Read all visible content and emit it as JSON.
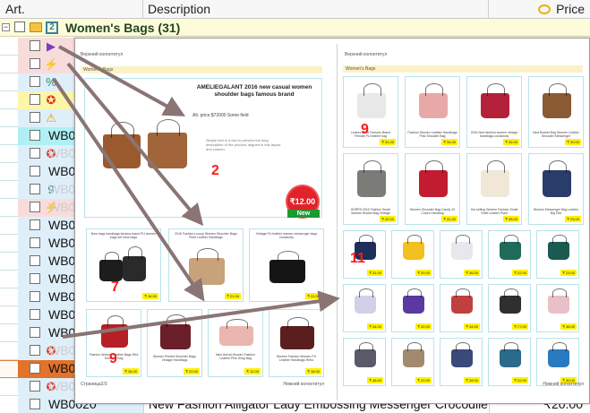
{
  "grid": {
    "columns": {
      "art": "Art.",
      "description": "Description",
      "price": "Price"
    },
    "group": {
      "toggle": "−",
      "icon_text": "2",
      "title": "Women's Bags   (31)"
    },
    "rows": [
      {
        "art": "",
        "icon": "flag-icon",
        "glyph": "▶",
        "desc": "",
        "price": ""
      },
      {
        "art": "",
        "icon": "lightning-icon",
        "glyph": "⚡",
        "desc": "",
        "price": ""
      },
      {
        "art": "",
        "icon": "percent-icon",
        "glyph": "%",
        "desc": "",
        "price": ""
      },
      {
        "art": "",
        "icon": "award-icon",
        "glyph": "✪",
        "desc": "",
        "price": ""
      },
      {
        "art": "",
        "icon": "warning-icon",
        "glyph": "⚠",
        "desc": "",
        "price": ""
      },
      {
        "art": "WB0",
        "icon": "",
        "glyph": "",
        "desc": "",
        "price": ""
      },
      {
        "art": "WB0",
        "icon": "award-icon",
        "glyph": "✪",
        "desc": "",
        "price": ""
      },
      {
        "art": "WB0",
        "icon": "",
        "glyph": "",
        "desc": "",
        "price": ""
      },
      {
        "art": "WB0",
        "icon": "nine-icon",
        "glyph": "9",
        "desc": "",
        "price": ""
      },
      {
        "art": "WB0",
        "icon": "lightning-icon",
        "glyph": "⚡",
        "desc": "",
        "price": ""
      },
      {
        "art": "WB0",
        "icon": "",
        "glyph": "",
        "desc": "",
        "price": ""
      },
      {
        "art": "WB0",
        "icon": "",
        "glyph": "",
        "desc": "",
        "price": ""
      },
      {
        "art": "WB0",
        "icon": "",
        "glyph": "",
        "desc": "",
        "price": ""
      },
      {
        "art": "WB0",
        "icon": "",
        "glyph": "",
        "desc": "",
        "price": ""
      },
      {
        "art": "WB0",
        "icon": "",
        "glyph": "",
        "desc": "",
        "price": ""
      },
      {
        "art": "WB0",
        "icon": "",
        "glyph": "",
        "desc": "",
        "price": ""
      },
      {
        "art": "WB0",
        "icon": "",
        "glyph": "",
        "desc": "",
        "price": ""
      },
      {
        "art": "WB0",
        "icon": "award-icon",
        "glyph": "✪",
        "desc": "",
        "price": ""
      },
      {
        "art": "WB0",
        "icon": "",
        "glyph": "",
        "desc": "",
        "price": ""
      },
      {
        "art": "WB0",
        "icon": "award-icon",
        "glyph": "✪",
        "desc": "",
        "price": ""
      },
      {
        "art": "WB0020",
        "icon": "",
        "glyph": "",
        "desc": "New Fashion Alligator Lady Embossing Messenger Crocodile",
        "price": "₹20.00"
      }
    ]
  },
  "preview": {
    "left": {
      "header": "Верхний колонтитул",
      "group": "Women's Bags",
      "big": {
        "title": "AMELIEGALANT 2016 new casual women shoulder bags famous brand",
        "alt": "Alt. price:$72000 Some field",
        "lorem": "Simple text in a box to preview the long description of the product, aligned in this layout and column.",
        "price": "₹12.00",
        "badge": "New"
      },
      "mid": [
        {
          "cap": "New bags handbags famous brand PU women bags set lotus bags",
          "price": "₹ 16.00"
        },
        {
          "cap": "2016 Fashion Luxury Women Shoulder Bags Rivet Leather Handbags",
          "price": "₹ 21.00"
        },
        {
          "cap": "Vintage PU leather women messenger bags crossbody",
          "price": "₹ 22.00"
        }
      ],
      "bottom": [
        {
          "cap": "Fashion Women Leather Bags Red Shoulder bag",
          "price": "₹ 36.00"
        },
        {
          "cap": "Women Printed Shoulder Bags Vintage Handbags",
          "price": "₹ 22.00"
        },
        {
          "cap": "New Arrival Women Fashion Leather Pink Sling Bag",
          "price": "₹ 12.00"
        },
        {
          "cap": "Women Fashion Women PU Leather Handbags Retro",
          "price": "₹ 18.00"
        }
      ],
      "footer_left": "Страница2/3",
      "footer_right": "Нижний колонтитул"
    },
    "right": {
      "header": "Верхний колонтитул",
      "group": "Women's Bags",
      "row1": [
        {
          "cap": "Leisure 2016 Famous Brand Female PU leather bag",
          "price": "₹ 31.00"
        },
        {
          "cap": "Fashion Women Leather Handbags Pink Shoulder Bag",
          "price": "₹ 34.00"
        },
        {
          "cap": "2016 New fashion women vintage handbags crossbody",
          "price": "₹ 35.00"
        },
        {
          "cap": "New Bucket Bag Women Leather Shoulder Messenger",
          "price": "₹ 20.00"
        }
      ],
      "row2": [
        {
          "cap": "BVRFB 2016 Fashion Small Women Bucket Bag Vintage",
          "price": "₹ 22.00"
        },
        {
          "cap": "Women Shoulder Bag Candy 10 Colors Handbag",
          "price": "₹ 41.00"
        },
        {
          "cap": "Hot selling Women Fashion Small Shell Leather Plaid",
          "price": "₹ 35.00"
        },
        {
          "cap": "Women Messenger Bag Leather Big Tote",
          "price": "₹ 23.00"
        }
      ],
      "row3": [
        "₹ 31.00",
        "₹ 20.00",
        "₹ 36.00",
        "₹ 22.00",
        "₹ 23.00"
      ],
      "row4": [
        "₹ 34.00",
        "₹ 32.00",
        "₹ 34.00",
        "₹ 77.00",
        "₹ 36.00"
      ],
      "row5": [
        "₹ 48.00",
        "₹ 22.00",
        "₹ 28.00",
        "₹ 22.00",
        "₹ 30.00"
      ],
      "footer_right": "Нижний колонтитул"
    },
    "annotations": {
      "n2": "2",
      "n7": "7",
      "n9a": "9",
      "n9b": "9",
      "n11": "11"
    }
  },
  "colors": {
    "group_bg": "#fdfbd9",
    "row_pink": "#f8dcdc",
    "row_yellow": "#fdf6a8",
    "row_cyan": "#aef0f4",
    "row_orange": "#e2732a",
    "arrow": "#8a7474",
    "price_tag": "#fff200",
    "burst_red": "#e0222a",
    "badge_green": "#1c9a2e"
  }
}
